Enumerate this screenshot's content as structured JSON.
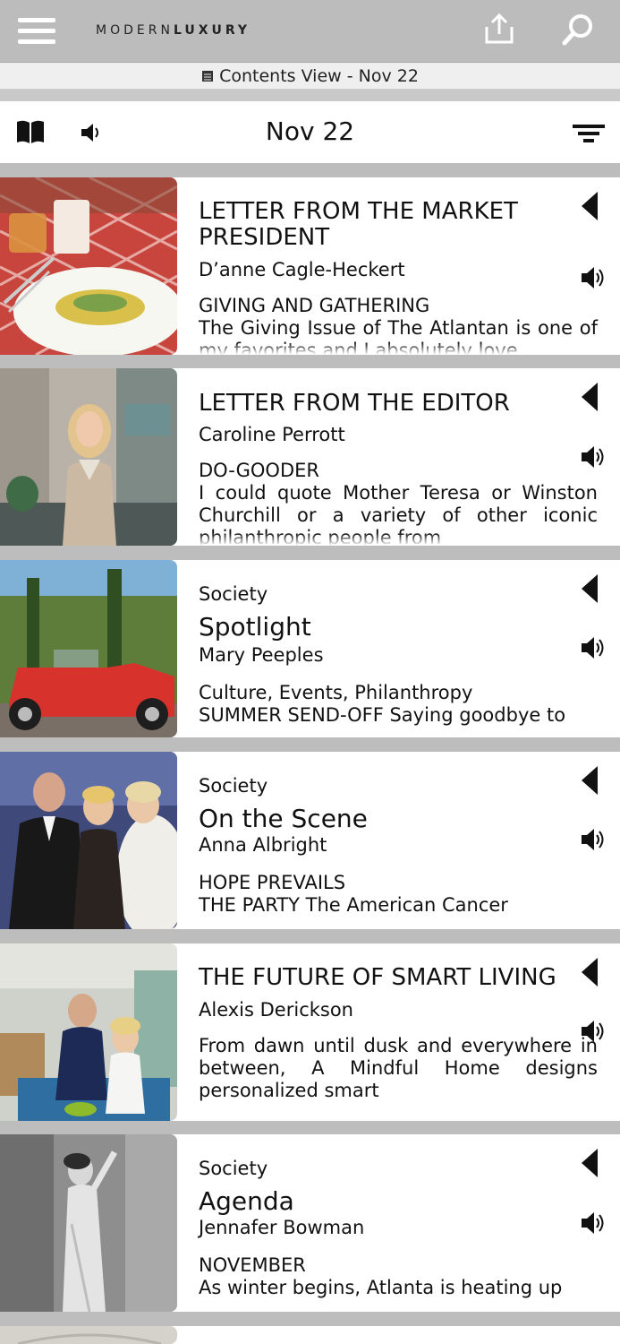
{
  "header": {
    "brand_light": "MODERN",
    "brand_bold": "LUXURY"
  },
  "subheader": {
    "label": "Contents View - Nov 22"
  },
  "toolbar": {
    "issue": "Nov 22"
  },
  "articles": [
    {
      "kicker": "",
      "title": "LETTER FROM THE MARKET PRESIDENT",
      "author": "D’anne Cagle-Heckert",
      "section": "GIVING AND GATHERING",
      "excerpt": "The Giving Issue of The Atlantan is one of my favorites and I absolutely love",
      "thumb": "table-setting"
    },
    {
      "kicker": "",
      "title": "LETTER FROM THE EDITOR",
      "author": "Caroline Perrott",
      "section": "DO-GOODER",
      "excerpt": "I could quote Mother Teresa or Winston Churchill or a variety of other iconic philanthropic people from",
      "thumb": "woman-portrait"
    },
    {
      "kicker": "Society",
      "title": "Spotlight",
      "author": "Mary Peeples",
      "section": "Culture, Events, Philanthropy",
      "excerpt": "SUMMER SEND-OFF Saying goodbye to",
      "thumb": "red-truck"
    },
    {
      "kicker": "Society",
      "title": "On the Scene",
      "author": "Anna Albright",
      "section": "HOPE PREVAILS",
      "excerpt": "THE PARTY The American Cancer",
      "thumb": "group-photo"
    },
    {
      "kicker": "",
      "title": "THE FUTURE OF SMART LIVING",
      "author": "Alexis Derickson",
      "section": "",
      "excerpt": "From dawn until dusk and everywhere in between, A Mindful Home designs personalized smart",
      "thumb": "couple-living-room"
    },
    {
      "kicker": "Society",
      "title": "Agenda",
      "author": "Jennafer Bowman",
      "section": "NOVEMBER",
      "excerpt": "As winter begins, Atlanta is heating up",
      "thumb": "vintage-gown"
    }
  ],
  "colors": {
    "background": "#bdbdbd",
    "topbar": "#bcbcbc",
    "card": "#ffffff",
    "text": "#111111"
  }
}
